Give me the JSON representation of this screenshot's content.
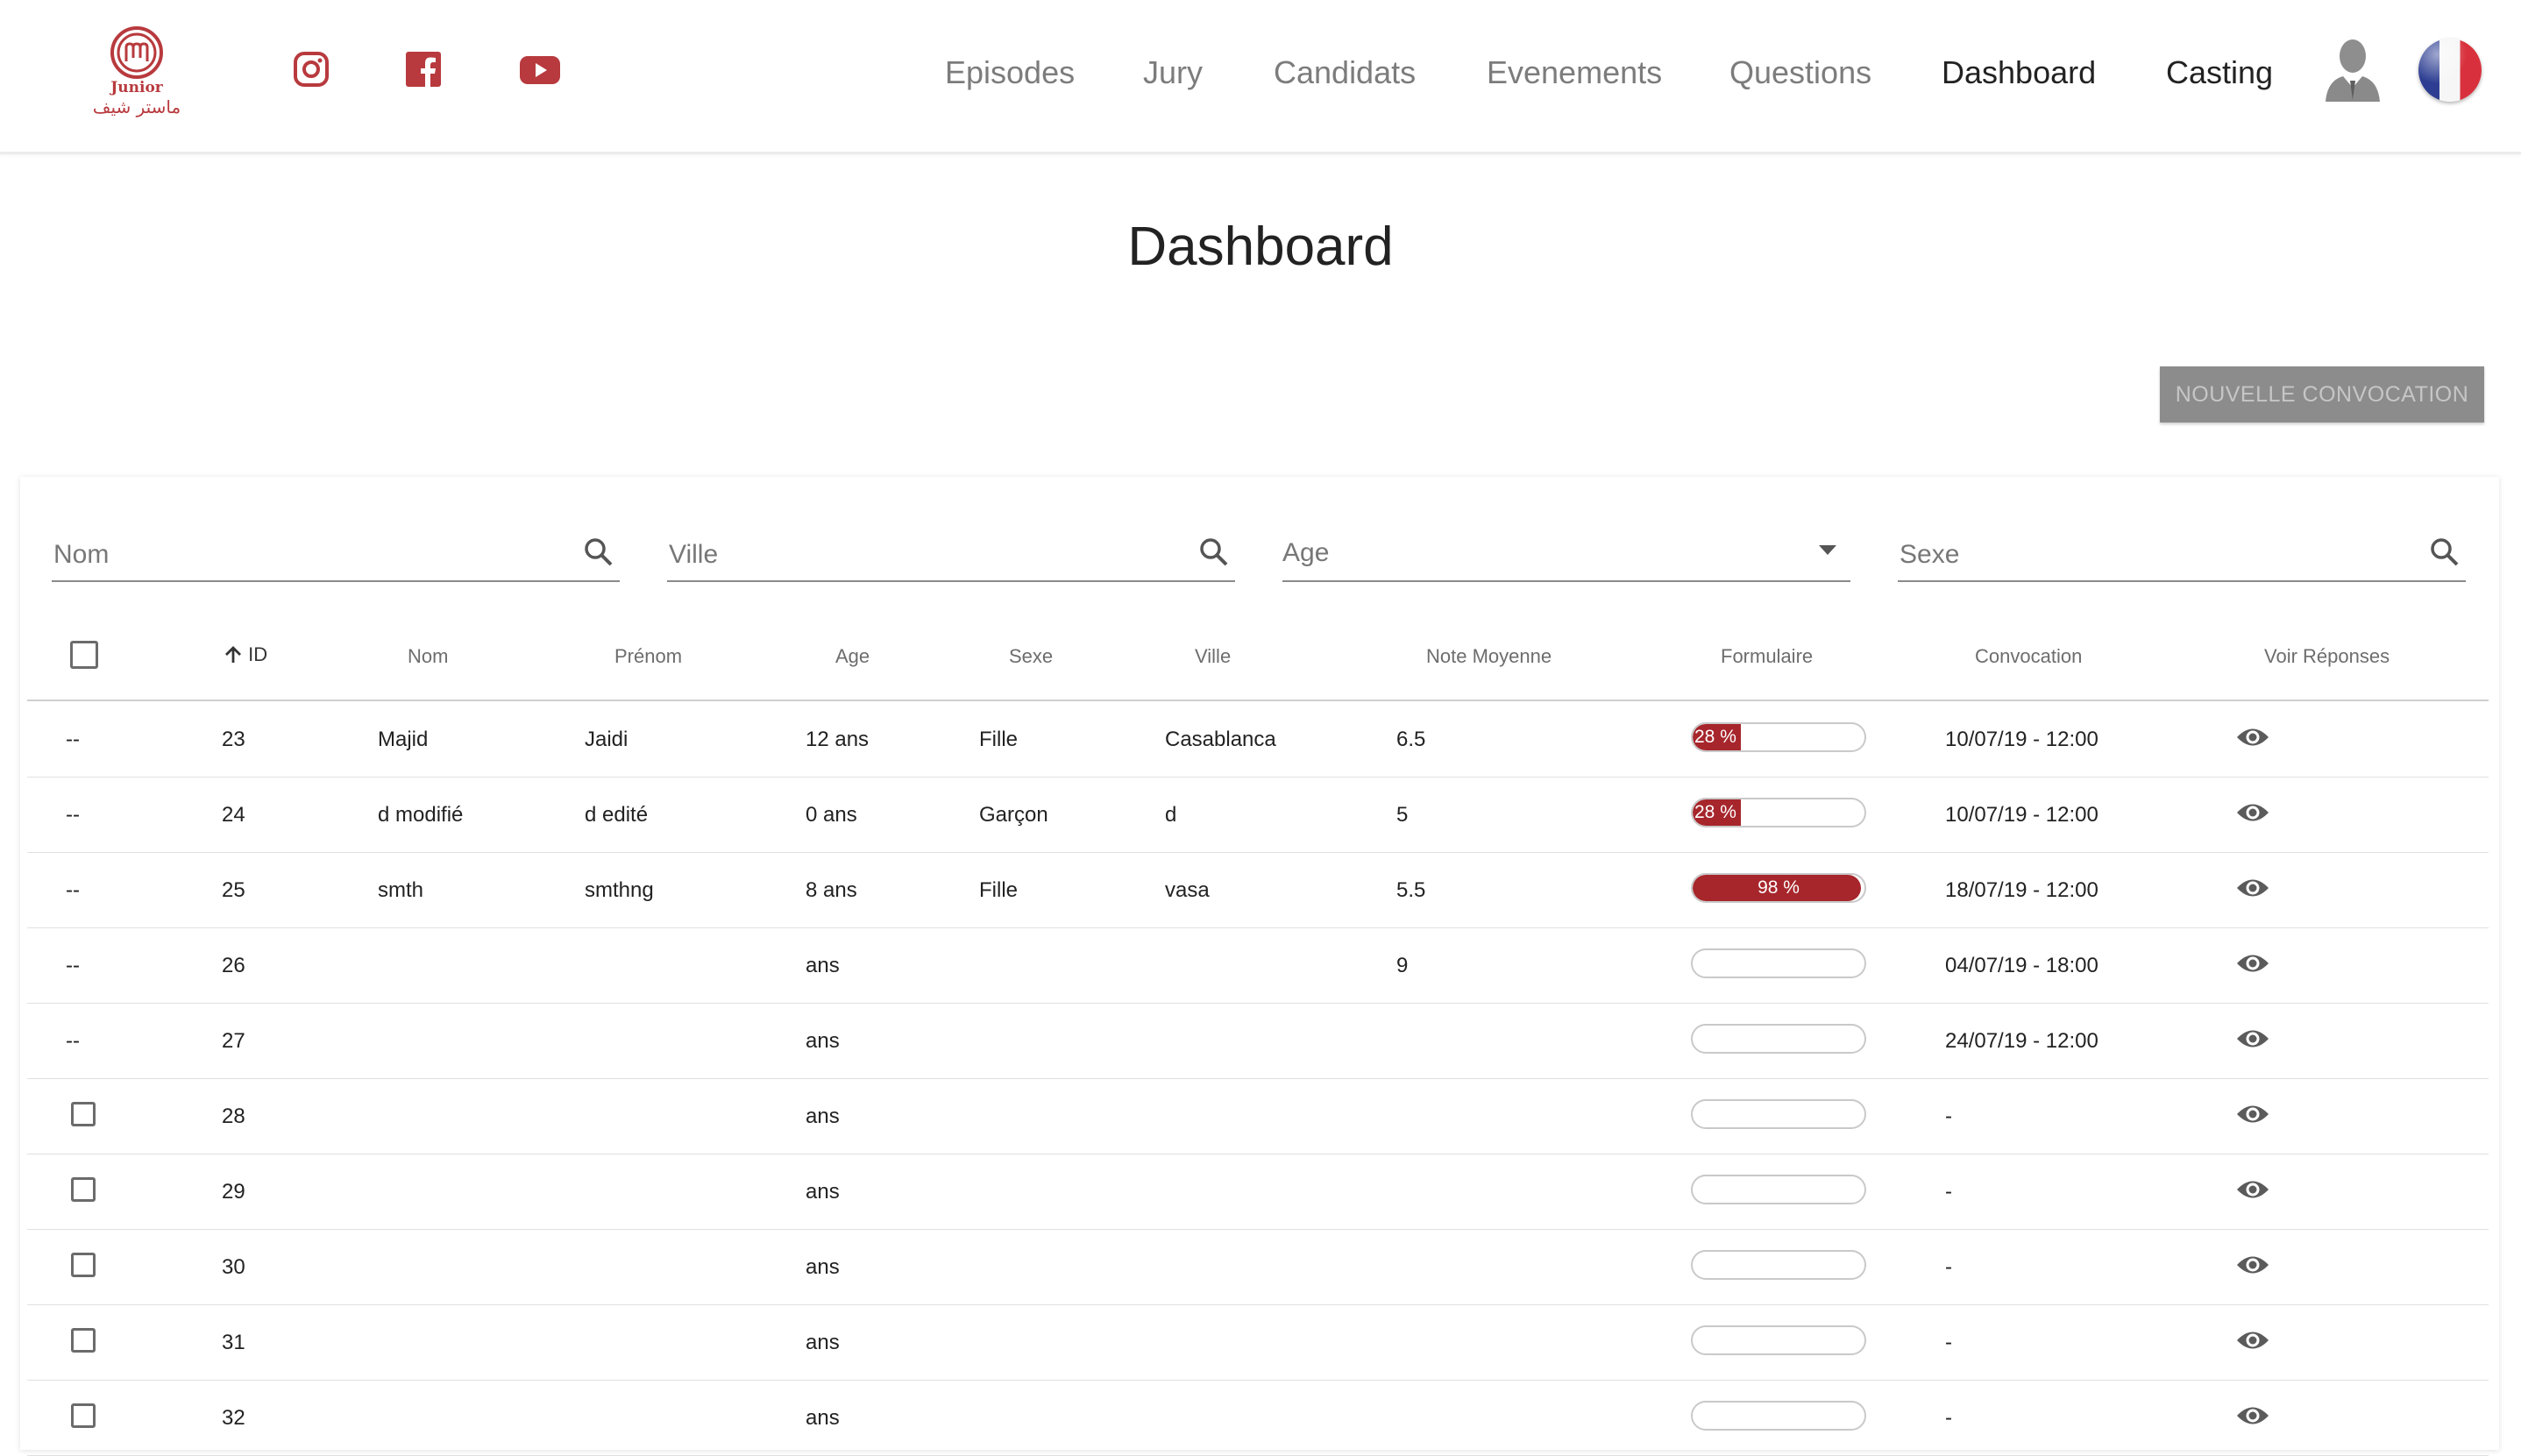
{
  "header": {
    "logo": {
      "line1": "Junior",
      "line2": "ماستر شيف"
    },
    "social": [
      "instagram-icon",
      "facebook-icon",
      "youtube-icon"
    ],
    "nav": [
      {
        "label": "Episodes",
        "active": false
      },
      {
        "label": "Jury",
        "active": false
      },
      {
        "label": "Candidats",
        "active": false
      },
      {
        "label": "Evenements",
        "active": false
      },
      {
        "label": "Questions",
        "active": false
      },
      {
        "label": "Dashboard",
        "active": true
      },
      {
        "label": "Casting",
        "active": false
      }
    ],
    "language": "FR"
  },
  "page": {
    "title": "Dashboard",
    "new_button": "NOUVELLE CONVOCATION"
  },
  "filters": {
    "nom_placeholder": "Nom",
    "ville_placeholder": "Ville",
    "age_value": "Age",
    "sexe_placeholder": "Sexe"
  },
  "table": {
    "columns": [
      "ID",
      "Nom",
      "Prénom",
      "Age",
      "Sexe",
      "Ville",
      "Note Moyenne",
      "Formulaire",
      "Convocation",
      "Voir Réponses"
    ],
    "sort": {
      "column": "ID",
      "direction": "asc"
    },
    "rows": [
      {
        "select": "--",
        "id": "23",
        "nom": "Majid",
        "prenom": "Jaidi",
        "age": "12 ans",
        "sexe": "Fille",
        "ville": "Casablanca",
        "note": "6.5",
        "formulaire": 28,
        "formulaire_label": "28 %",
        "convocation": "10/07/19 - 12:00"
      },
      {
        "select": "--",
        "id": "24",
        "nom": "d modifié",
        "prenom": "d edité",
        "age": "0 ans",
        "sexe": "Garçon",
        "ville": "d",
        "note": "5",
        "formulaire": 28,
        "formulaire_label": "28 %",
        "convocation": "10/07/19 - 12:00"
      },
      {
        "select": "--",
        "id": "25",
        "nom": "smth",
        "prenom": "smthng",
        "age": "8 ans",
        "sexe": "Fille",
        "ville": "vasa",
        "note": "5.5",
        "formulaire": 98,
        "formulaire_label": "98 %",
        "convocation": "18/07/19 - 12:00"
      },
      {
        "select": "--",
        "id": "26",
        "nom": "",
        "prenom": "",
        "age": "ans",
        "sexe": "",
        "ville": "",
        "note": "9",
        "formulaire": 0,
        "formulaire_label": "",
        "convocation": "04/07/19 - 18:00"
      },
      {
        "select": "--",
        "id": "27",
        "nom": "",
        "prenom": "",
        "age": "ans",
        "sexe": "",
        "ville": "",
        "note": "",
        "formulaire": 0,
        "formulaire_label": "",
        "convocation": "24/07/19 - 12:00"
      },
      {
        "select": "checkbox",
        "id": "28",
        "nom": "",
        "prenom": "",
        "age": "ans",
        "sexe": "",
        "ville": "",
        "note": "",
        "formulaire": 0,
        "formulaire_label": "",
        "convocation": "-"
      },
      {
        "select": "checkbox",
        "id": "29",
        "nom": "",
        "prenom": "",
        "age": "ans",
        "sexe": "",
        "ville": "",
        "note": "",
        "formulaire": 0,
        "formulaire_label": "",
        "convocation": "-"
      },
      {
        "select": "checkbox",
        "id": "30",
        "nom": "",
        "prenom": "",
        "age": "ans",
        "sexe": "",
        "ville": "",
        "note": "",
        "formulaire": 0,
        "formulaire_label": "",
        "convocation": "-"
      },
      {
        "select": "checkbox",
        "id": "31",
        "nom": "",
        "prenom": "",
        "age": "ans",
        "sexe": "",
        "ville": "",
        "note": "",
        "formulaire": 0,
        "formulaire_label": "",
        "convocation": "-"
      },
      {
        "select": "checkbox",
        "id": "32",
        "nom": "",
        "prenom": "",
        "age": "ans",
        "sexe": "",
        "ville": "",
        "note": "",
        "formulaire": 0,
        "formulaire_label": "",
        "convocation": "-"
      }
    ]
  },
  "colors": {
    "brand": "#b83a3e",
    "progress_fill": "#a6262c",
    "button_disabled": "#8c8c8c"
  }
}
